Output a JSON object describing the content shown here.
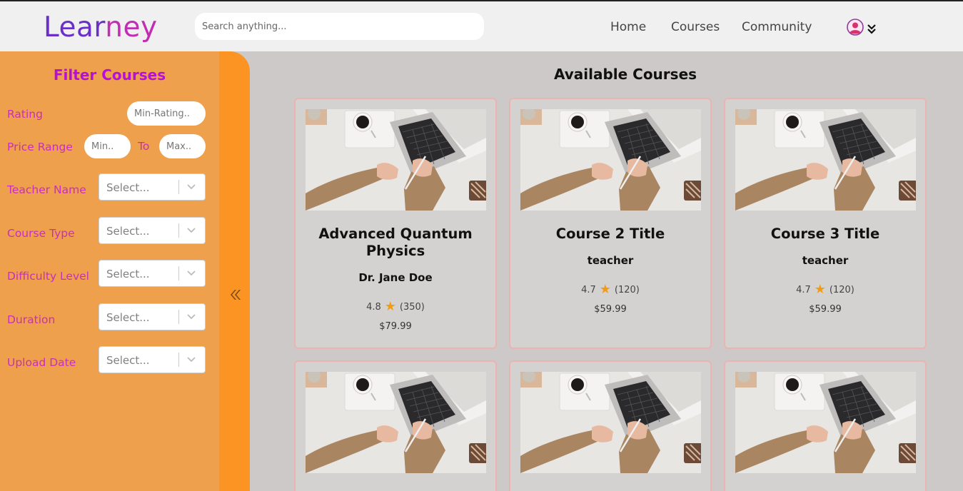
{
  "header": {
    "logo": "Learney",
    "search_placeholder": "Search anything...",
    "nav": [
      "Home",
      "Courses",
      "Community"
    ]
  },
  "sidebar": {
    "title": "Filter Courses",
    "rating_label": "Rating",
    "rating_placeholder": "Min-Rating..",
    "price_label": "Price Range",
    "price_min_placeholder": "Min..",
    "price_to": "To",
    "price_max_placeholder": "Max..",
    "filters": [
      {
        "label": "Teacher Name",
        "placeholder": "Select..."
      },
      {
        "label": "Course Type",
        "placeholder": "Select..."
      },
      {
        "label": "Difficulty Level",
        "placeholder": "Select..."
      },
      {
        "label": "Duration",
        "placeholder": "Select..."
      },
      {
        "label": "Upload Date",
        "placeholder": "Select..."
      }
    ]
  },
  "main": {
    "title": "Available Courses",
    "courses": [
      {
        "title": "Advanced Quantum Physics",
        "teacher": "Dr. Jane Doe",
        "rating": "4.8",
        "reviews": "(350)",
        "price": "$79.99"
      },
      {
        "title": "Course 2 Title",
        "teacher": "teacher",
        "rating": "4.7",
        "reviews": "(120)",
        "price": "$59.99"
      },
      {
        "title": "Course 3 Title",
        "teacher": "teacher",
        "rating": "4.7",
        "reviews": "(120)",
        "price": "$59.99"
      },
      {
        "title": "",
        "teacher": "",
        "rating": "",
        "reviews": "",
        "price": ""
      },
      {
        "title": "",
        "teacher": "",
        "rating": "",
        "reviews": "",
        "price": ""
      },
      {
        "title": "",
        "teacher": "",
        "rating": "",
        "reviews": "",
        "price": ""
      }
    ],
    "star_glyph": "★"
  },
  "colors": {
    "brand_purple": "#6a2fc6",
    "filter_title": "#b510d7",
    "filter_label": "#c72fbe",
    "sidebar_orange": "#fb9423",
    "sidebar_panel": "#eea04c",
    "card_border": "#edb3b3",
    "star": "#f39c12"
  }
}
